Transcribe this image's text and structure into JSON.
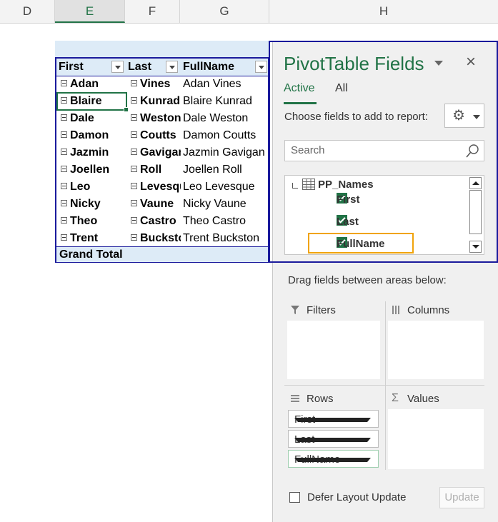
{
  "columns": [
    "D",
    "E",
    "F",
    "G",
    "H"
  ],
  "pivot": {
    "headers": {
      "first": "First",
      "last": "Last",
      "fullname": "FullName"
    },
    "rows": [
      {
        "first": "Adan",
        "last": "Vines",
        "full": "Adan  Vines"
      },
      {
        "first": "Blaire",
        "last": "Kunrad",
        "full": "Blaire  Kunrad"
      },
      {
        "first": "Dale",
        "last": "Weston",
        "full": "Dale  Weston"
      },
      {
        "first": "Damon",
        "last": "Coutts",
        "full": "Damon  Coutts"
      },
      {
        "first": "Jazmin",
        "last": "Gavigan",
        "full": "Jazmin  Gavigan"
      },
      {
        "first": "Joellen",
        "last": "Roll",
        "full": "Joellen  Roll"
      },
      {
        "first": "Leo",
        "last": "Levesque",
        "full": "Leo  Levesque"
      },
      {
        "first": "Nicky",
        "last": "Vaune",
        "full": "Nicky  Vaune"
      },
      {
        "first": "Theo",
        "last": "Castro",
        "full": "Theo  Castro"
      },
      {
        "first": "Trent",
        "last": "Buckston",
        "full": "Trent  Buckston"
      }
    ],
    "grand_total": "Grand Total"
  },
  "pane": {
    "title": "PivotTable Fields",
    "close": "×",
    "tabs": {
      "active": "Active",
      "all": "All"
    },
    "choose_label": "Choose fields to add to report:",
    "search_placeholder": "Search",
    "table_name": "PP_Names",
    "fields": {
      "first": "First",
      "last": "Last",
      "fullname": "FullName"
    },
    "drag_label": "Drag fields between areas below:",
    "areas": {
      "filters": "Filters",
      "columns": "Columns",
      "rows": "Rows",
      "values": "Values"
    },
    "row_fields": {
      "first": "First",
      "last": "Last",
      "fullname": "FullName"
    },
    "defer_label": "Defer Layout Update",
    "update_label": "Update"
  }
}
